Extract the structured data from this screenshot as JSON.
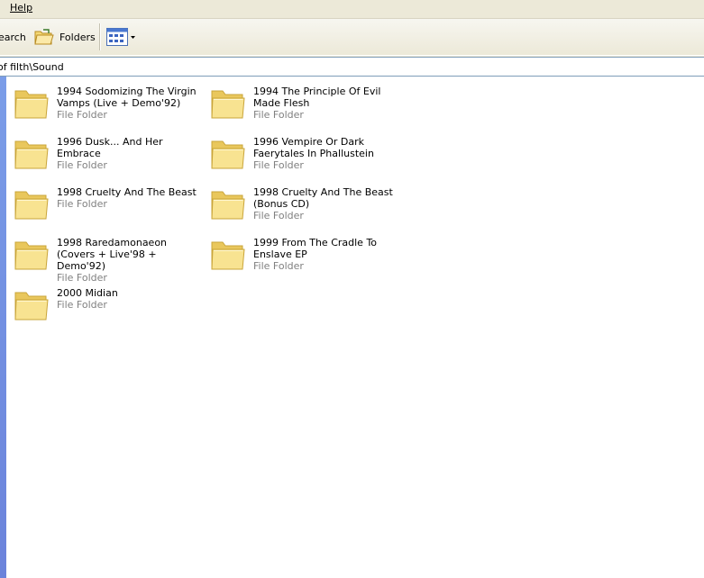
{
  "menubar": {
    "help_label": "Help"
  },
  "toolbar": {
    "search_label": "earch",
    "folders_label": "Folders"
  },
  "address": {
    "path": "of filth\\Sound"
  },
  "colors": {
    "folder_fill": "#f6e08c",
    "folder_outline": "#c9a53a",
    "side_panel": "#7b9de8"
  },
  "folders": [
    {
      "name": "1994 Sodomizing The Virgin Vamps (Live + Demo'92)",
      "type": "File Folder"
    },
    {
      "name": "1994 The Principle Of Evil Made Flesh",
      "type": "File Folder"
    },
    {
      "name": "1996 Dusk... And Her Embrace",
      "type": "File Folder"
    },
    {
      "name": "1996 Vempire Or Dark Faerytales In Phallustein",
      "type": "File Folder"
    },
    {
      "name": "1998 Cruelty And The Beast",
      "type": "File Folder"
    },
    {
      "name": "1998 Cruelty And The Beast (Bonus CD)",
      "type": "File Folder"
    },
    {
      "name": "1998 Raredamonaeon (Covers + Live'98 + Demo'92)",
      "type": "File Folder"
    },
    {
      "name": "1999 From The Cradle To Enslave EP",
      "type": "File Folder"
    },
    {
      "name": "2000 Midian",
      "type": "File Folder"
    }
  ]
}
